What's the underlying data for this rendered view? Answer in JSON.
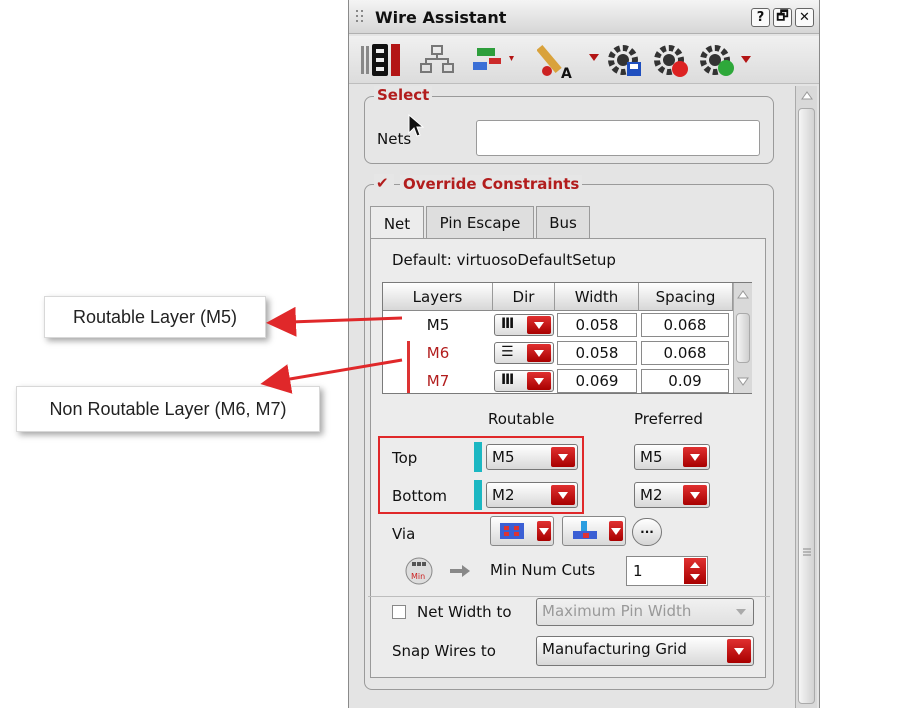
{
  "callouts": {
    "routable": "Routable Layer (M5)",
    "non_routable": "Non Routable Layer (M6, M7)"
  },
  "window": {
    "title": "Wire Assistant",
    "help_label": "?",
    "float_label": "🗗",
    "close_label": "✕"
  },
  "select": {
    "title": "Select",
    "nets_label": "Nets",
    "nets_value": ""
  },
  "override": {
    "checkbox_mark": "✔",
    "title": "Override Constraints",
    "checked": true
  },
  "tabs": [
    "Net",
    "Pin Escape",
    "Bus"
  ],
  "default_setup": "Default: virtuosoDefaultSetup",
  "table": {
    "headers": [
      "Layers",
      "Dir",
      "Width",
      "Spacing"
    ],
    "rows": [
      {
        "layer": "M5",
        "dir_icon": "Ⅲ",
        "width": "0.058",
        "spacing": "0.068"
      },
      {
        "layer": "M6",
        "dir_icon": "☰",
        "width": "0.058",
        "spacing": "0.068"
      },
      {
        "layer": "M7",
        "dir_icon": "Ⅲ",
        "width": "0.069",
        "spacing": "0.09"
      }
    ]
  },
  "layers": {
    "routable_header": "Routable",
    "preferred_header": "Preferred",
    "top_label": "Top",
    "bottom_label": "Bottom",
    "top_routable": "M5",
    "bottom_routable": "M2",
    "top_preferred": "M5",
    "bottom_preferred": "M2"
  },
  "via": {
    "label": "Via",
    "more_label": "···",
    "min_num_cuts_label": "Min Num Cuts",
    "min_num_cuts_value": "1",
    "min_icon_text": "Min"
  },
  "net_width": {
    "label": "Net Width to",
    "value": "Maximum Pin Width",
    "checked": false
  },
  "snap": {
    "label": "Snap Wires to",
    "value": "Manufacturing Grid"
  },
  "colors": {
    "accent_red": "#b21d1d",
    "teal": "#1bb7c2",
    "non_routable_text": "#b21d1d"
  }
}
